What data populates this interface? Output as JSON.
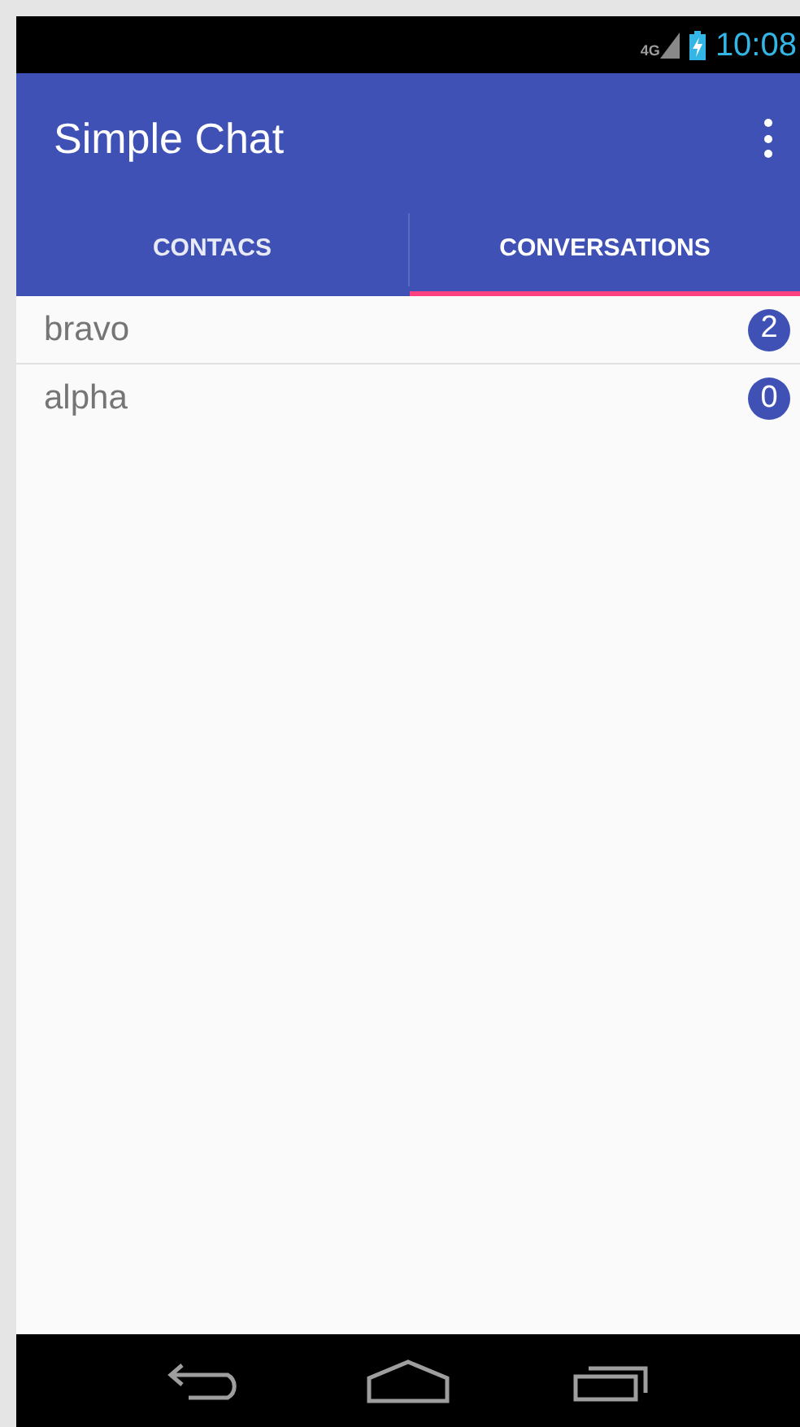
{
  "status_bar": {
    "network": "4G",
    "time": "10:08"
  },
  "app_bar": {
    "title": "Simple Chat"
  },
  "tabs": [
    {
      "label": "CONTACS",
      "selected": false
    },
    {
      "label": "CONVERSATIONS",
      "selected": true
    }
  ],
  "conversations": [
    {
      "name": "bravo",
      "count": "2"
    },
    {
      "name": "alpha",
      "count": "0"
    }
  ]
}
